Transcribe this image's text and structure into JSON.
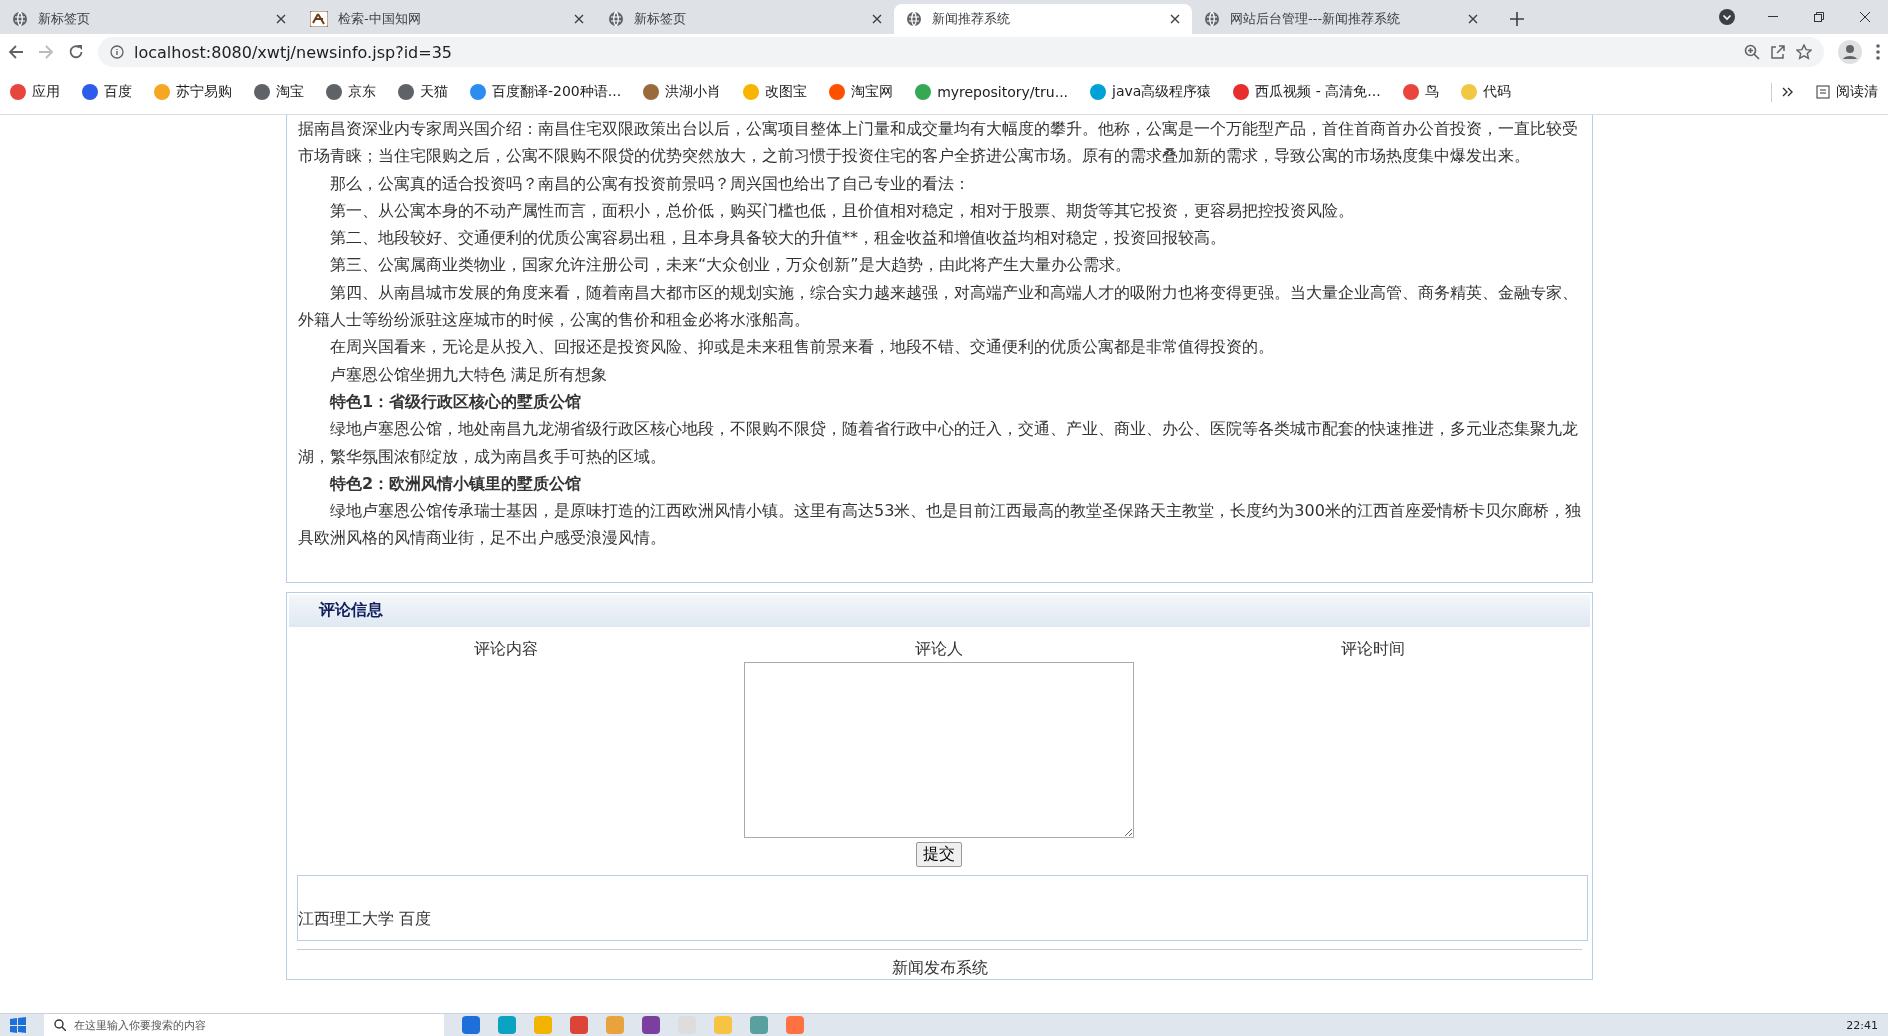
{
  "browser": {
    "tabs": [
      {
        "title": "新标签页",
        "kind": "page",
        "selected": false
      },
      {
        "title": "检索-中国知网",
        "kind": "site",
        "selected": false
      },
      {
        "title": "新标签页",
        "kind": "page",
        "selected": false
      },
      {
        "title": "新闻推荐系统",
        "kind": "page",
        "selected": true
      },
      {
        "title": "网站后台管理---新闻推荐系统",
        "kind": "page",
        "selected": false
      }
    ],
    "address": "localhost:8080/xwtj/newsinfo.jsp?id=35",
    "bookmarks": [
      {
        "label": "应用",
        "color": "#e8453c"
      },
      {
        "label": "百度",
        "color": "#2f5bea"
      },
      {
        "label": "苏宁易购",
        "color": "#f5a623"
      },
      {
        "label": "淘宝",
        "color": "#5f6368"
      },
      {
        "label": "京东",
        "color": "#5f6368"
      },
      {
        "label": "天猫",
        "color": "#5f6368"
      },
      {
        "label": "百度翻译-200种语...",
        "color": "#2d8cf0"
      },
      {
        "label": "洪湖小肖",
        "color": "#9b6a3c"
      },
      {
        "label": "改图宝",
        "color": "#f7b500"
      },
      {
        "label": "淘宝网",
        "color": "#ff5000"
      },
      {
        "label": "myrepository/tru...",
        "color": "#34a853"
      },
      {
        "label": "java高级程序猿",
        "color": "#00a1d6"
      },
      {
        "label": "西瓜视频 - 高清免...",
        "color": "#e62e2e"
      },
      {
        "label": "鸟",
        "color": "#e8453c"
      },
      {
        "label": "代码",
        "color": "#f2c744"
      }
    ],
    "reading_list": "阅读清"
  },
  "article": {
    "paragraphs": [
      {
        "kind": "plain",
        "text": "据南昌资深业内专家周兴国介绍：南昌住宅双限政策出台以后，公寓项目整体上门量和成交量均有大幅度的攀升。他称，公寓是一个万能型产品，首住首商首办公首投资，一直比较受市场青睐；当住宅限购之后，公寓不限购不限贷的优势突然放大，之前习惯于投资住宅的客户全挤进公寓市场。原有的需求叠加新的需求，导致公寓的市场热度集中爆发出来。"
      },
      {
        "kind": "body",
        "text": "那么，公寓真的适合投资吗？南昌的公寓有投资前景吗？周兴国也给出了自己专业的看法："
      },
      {
        "kind": "body",
        "text": "第一、从公寓本身的不动产属性而言，面积小，总价低，购买门槛也低，且价值相对稳定，相对于股票、期货等其它投资，更容易把控投资风险。"
      },
      {
        "kind": "body",
        "text": "第二、地段较好、交通便利的优质公寓容易出租，且本身具备较大的升值**，租金收益和增值收益均相对稳定，投资回报较高。"
      },
      {
        "kind": "body",
        "text": "第三、公寓属商业类物业，国家允许注册公司，未来“大众创业，万众创新”是大趋势，由此将产生大量办公需求。"
      },
      {
        "kind": "body",
        "text": "第四、从南昌城市发展的角度来看，随着南昌大都市区的规划实施，综合实力越来越强，对高端产业和高端人才的吸附力也将变得更强。当大量企业高管、商务精英、金融专家、外籍人士等纷纷派驻这座城市的时候，公寓的售价和租金必将水涨船高。"
      },
      {
        "kind": "body",
        "text": "在周兴国看来，无论是从投入、回报还是投资风险、抑或是未来租售前景来看，地段不错、交通便利的优质公寓都是非常值得投资的。"
      },
      {
        "kind": "body",
        "text": "卢塞恩公馆坐拥九大特色 满足所有想象"
      },
      {
        "kind": "heading",
        "text": "特色1：省级行政区核心的墅质公馆"
      },
      {
        "kind": "body",
        "text": "绿地卢塞恩公馆，地处南昌九龙湖省级行政区核心地段，不限购不限贷，随着省行政中心的迁入，交通、产业、商业、办公、医院等各类城市配套的快速推进，多元业态集聚九龙湖，繁华氛围浓郁绽放，成为南昌炙手可热的区域。"
      },
      {
        "kind": "heading",
        "text": "特色2：欧洲风情小镇里的墅质公馆"
      },
      {
        "kind": "body",
        "text": "绿地卢塞恩公馆传承瑞士基因，是原味打造的江西欧洲风情小镇。这里有高达53米、也是目前江西最高的教堂圣保路天主教堂，长度约为300米的江西首座爱情桥卡贝尔廊桥，独具欧洲风格的风情商业街，足不出户感受浪漫风情。"
      }
    ]
  },
  "comments": {
    "title": "评论信息",
    "columns": [
      "评论内容",
      "评论人",
      "评论时间"
    ],
    "submit": "提交",
    "entries": [
      "江西理工大学 百度"
    ]
  },
  "footer": "新闻发布系统",
  "taskbar": {
    "search_placeholder": "在这里输入你要搜索的内容",
    "time": "22:41"
  }
}
